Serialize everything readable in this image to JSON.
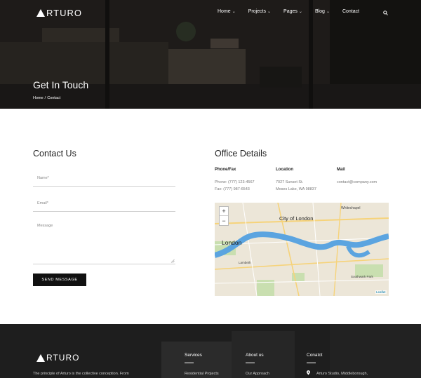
{
  "brand": {
    "logo": "RTURO"
  },
  "nav": [
    {
      "label": "Home",
      "chevron": "⌄"
    },
    {
      "label": "Projects",
      "chevron": "⌄"
    },
    {
      "label": "Pages",
      "chevron": "⌄"
    },
    {
      "label": "Blog",
      "chevron": "⌄"
    },
    {
      "label": "Contact",
      "chevron": ""
    }
  ],
  "search_icon": "search-icon",
  "hero": {
    "title": "Get In Touch",
    "breadcrumb_home": "Home",
    "breadcrumb_sep": "/",
    "breadcrumb_current": "Contact"
  },
  "contact_form": {
    "heading": "Contact Us",
    "name_placeholder": "Name*",
    "email_placeholder": "Email*",
    "message_placeholder": "Message",
    "send_label": "SEND MESSAGE"
  },
  "office": {
    "heading": "Office Details",
    "phone_heading": "Phone/Fax",
    "phone": "Phone: (777) 123-4567",
    "fax": "Fax: (777) 987-6543",
    "location_heading": "Location",
    "address_line1": "7027 Sunset St.",
    "address_line2": "Moses Lake, WA 98837",
    "mail_heading": "Mail",
    "email": "contact@company.com"
  },
  "map": {
    "zoom_in": "+",
    "zoom_out": "−",
    "labels": [
      "City of London",
      "London",
      "Whitechapel",
      "Southwark Park",
      "Lambeth",
      "Leaflet"
    ],
    "colors": {
      "land": "#ece6d8",
      "river": "#5ba4e0",
      "park": "#c9dfb0",
      "road": "#f6d37a"
    }
  },
  "footer": {
    "logo": "RTURO",
    "tagline": "The principle of Arturo is the collective conception. From",
    "services_heading": "Services",
    "services_first": "Residential Projects",
    "about_heading": "About us",
    "about_first": "Our Approach",
    "contact_heading": "Conatct",
    "contact_first": "Arturo Studio, Middleborough,"
  },
  "colors": {
    "accent": "#111111",
    "hero_overlay": "#2a2623",
    "footer_bg": "#1c1c1c"
  }
}
